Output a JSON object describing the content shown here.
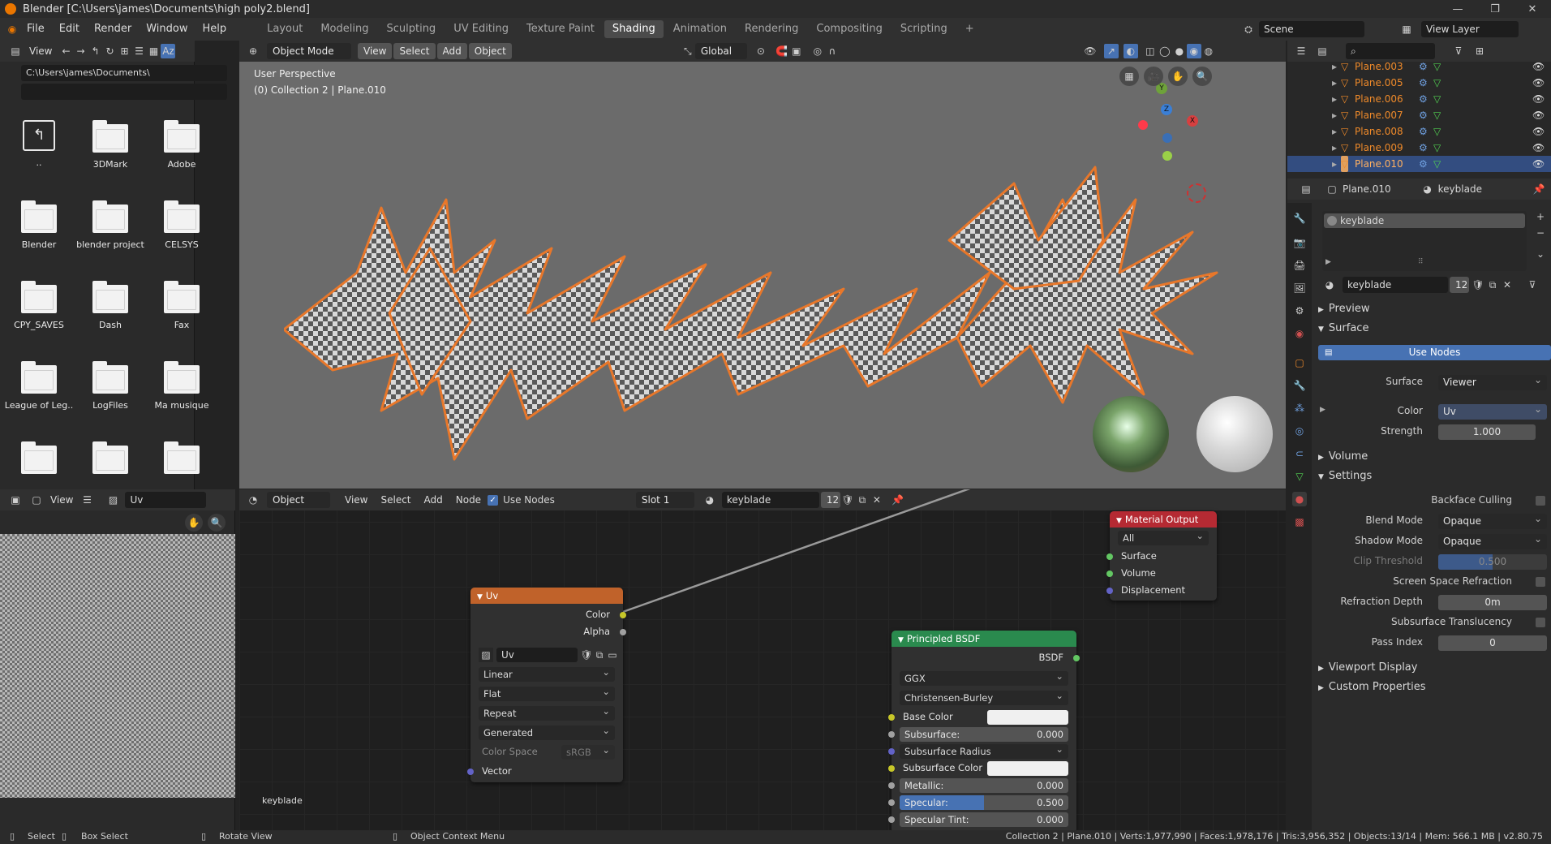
{
  "window": {
    "title": "Blender [C:\\Users\\james\\Documents\\high poly2.blend]"
  },
  "menubar": {
    "items": [
      "File",
      "Edit",
      "Render",
      "Window",
      "Help"
    ],
    "workspaces": [
      "Layout",
      "Modeling",
      "Sculpting",
      "UV Editing",
      "Texture Paint",
      "Shading",
      "Animation",
      "Rendering",
      "Compositing",
      "Scripting"
    ],
    "active_workspace": "Shading",
    "add_tab": "+",
    "scene": "Scene",
    "view_layer": "View Layer"
  },
  "filebrowser": {
    "view_label": "View",
    "path": "C:\\Users\\james\\Documents\\",
    "items": [
      "..",
      "3DMark",
      "Adobe",
      "Blender",
      "blender project",
      "CELSYS",
      "CPY_SAVES",
      "Dash",
      "Fax",
      "League of Leg..",
      "LogFiles",
      "Ma musique",
      "",
      "",
      ""
    ]
  },
  "viewport": {
    "mode": "Object Mode",
    "menus": [
      "View",
      "Select",
      "Add",
      "Object"
    ],
    "orientation": "Global",
    "overlay_line1": "User Perspective",
    "overlay_line2": "(0) Collection 2 | Plane.010",
    "gizmo": {
      "x": "X",
      "y": "Y",
      "z": "Z"
    }
  },
  "image_editor": {
    "view_label": "View",
    "image_name": "Uv",
    "footer_label": "keyblade"
  },
  "node_editor": {
    "type": "Object",
    "menus": [
      "View",
      "Select",
      "Add",
      "Node"
    ],
    "use_nodes": "Use Nodes",
    "slot": "Slot 1",
    "material": "keyblade",
    "users": "12",
    "uv_node": {
      "title": "Uv",
      "outputs": [
        "Color",
        "Alpha"
      ],
      "image": "Uv",
      "interpolation": "Linear",
      "projection": "Flat",
      "extension": "Repeat",
      "source": "Generated",
      "color_space_label": "Color Space",
      "color_space": "sRGB",
      "input": "Vector"
    },
    "material_output": {
      "title": "Material Output",
      "target": "All",
      "inputs": [
        "Surface",
        "Volume",
        "Displacement"
      ]
    },
    "bsdf": {
      "title": "Principled BSDF",
      "output": "BSDF",
      "distribution": "GGX",
      "subsurface_method": "Christensen-Burley",
      "base_color_label": "Base Color",
      "subsurface_label": "Subsurface:",
      "subsurface_value": "0.000",
      "subsurface_radius_label": "Subsurface Radius",
      "subsurface_color_label": "Subsurface Color",
      "metallic_label": "Metallic:",
      "metallic_value": "0.000",
      "specular_label": "Specular:",
      "specular_value": "0.500",
      "specular_fill": 0.5,
      "specular_tint_label": "Specular Tint:",
      "specular_tint_value": "0.000"
    }
  },
  "outliner": {
    "items": [
      "Plane.003",
      "Plane.005",
      "Plane.006",
      "Plane.007",
      "Plane.008",
      "Plane.009",
      "Plane.010"
    ],
    "selected": "Plane.010"
  },
  "properties": {
    "object": "Plane.010",
    "material_tab": "keyblade",
    "slot_name": "keyblade",
    "material_name": "keyblade",
    "users": "12",
    "preview_label": "Preview",
    "surface_section": "Surface",
    "use_nodes_button": "Use Nodes",
    "surface_label": "Surface",
    "surface_value": "Viewer",
    "color_label": "Color",
    "color_value": "Uv",
    "strength_label": "Strength",
    "strength_value": "1.000",
    "volume_section": "Volume",
    "settings_section": "Settings",
    "backface_culling": "Backface Culling",
    "blend_mode_label": "Blend Mode",
    "blend_mode": "Opaque",
    "shadow_mode_label": "Shadow Mode",
    "shadow_mode": "Opaque",
    "clip_threshold_label": "Clip Threshold",
    "clip_threshold": "0.500",
    "clip_fill": 0.5,
    "ssr_label": "Screen Space Refraction",
    "refraction_depth_label": "Refraction Depth",
    "refraction_depth": "0m",
    "sss_label": "Subsurface Translucency",
    "pass_index_label": "Pass Index",
    "pass_index": "0",
    "viewport_display": "Viewport Display",
    "custom_properties": "Custom Properties"
  },
  "statusbar": {
    "select": "Select",
    "box_select": "Box Select",
    "rotate_view": "Rotate View",
    "context_menu": "Object Context Menu",
    "stats": "Collection 2 | Plane.010 | Verts:1,977,990 | Faces:1,978,176 | Tris:3,956,352 | Objects:13/14 | Mem: 566.1 MB | v2.80.75"
  },
  "colors": {
    "accent_blue": "#4772b3",
    "selection_orange": "#ef8a2a",
    "node_texture_header": "#c0622a",
    "node_shader_header": "#2a8a4e",
    "node_output_header": "#b52a33"
  }
}
